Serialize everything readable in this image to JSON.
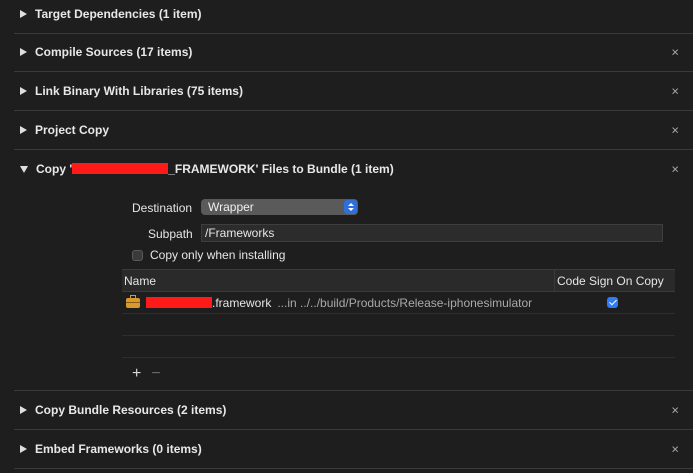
{
  "phases": [
    {
      "title": "Target Dependencies (1 item)",
      "closable": false
    },
    {
      "title": "Compile Sources (17 items)",
      "closable": true
    },
    {
      "title": "Link Binary With Libraries (75 items)",
      "closable": true
    },
    {
      "title": "Project Copy",
      "closable": true
    }
  ],
  "copy_phase": {
    "title_prefix": "Copy '",
    "title_suffix": "_FRAMEWORK' Files to Bundle (1 item)",
    "destination_label": "Destination",
    "destination_value": "Wrapper",
    "subpath_label": "Subpath",
    "subpath_value": "/Frameworks",
    "copy_only_label": "Copy only when installing",
    "copy_only_checked": false,
    "table": {
      "col_name": "Name",
      "col_codesign": "Code Sign On Copy",
      "rows": [
        {
          "name_suffix": ".framework",
          "path": "...in ../../build/Products/Release-iphonesimulator",
          "code_sign": true
        }
      ]
    },
    "add_label": "+",
    "remove_label": "−"
  },
  "bottom_phases": [
    {
      "title": "Copy Bundle Resources (2 items)",
      "closable": true
    },
    {
      "title": "Embed Frameworks (0 items)",
      "closable": true
    }
  ],
  "close_glyph": "×"
}
